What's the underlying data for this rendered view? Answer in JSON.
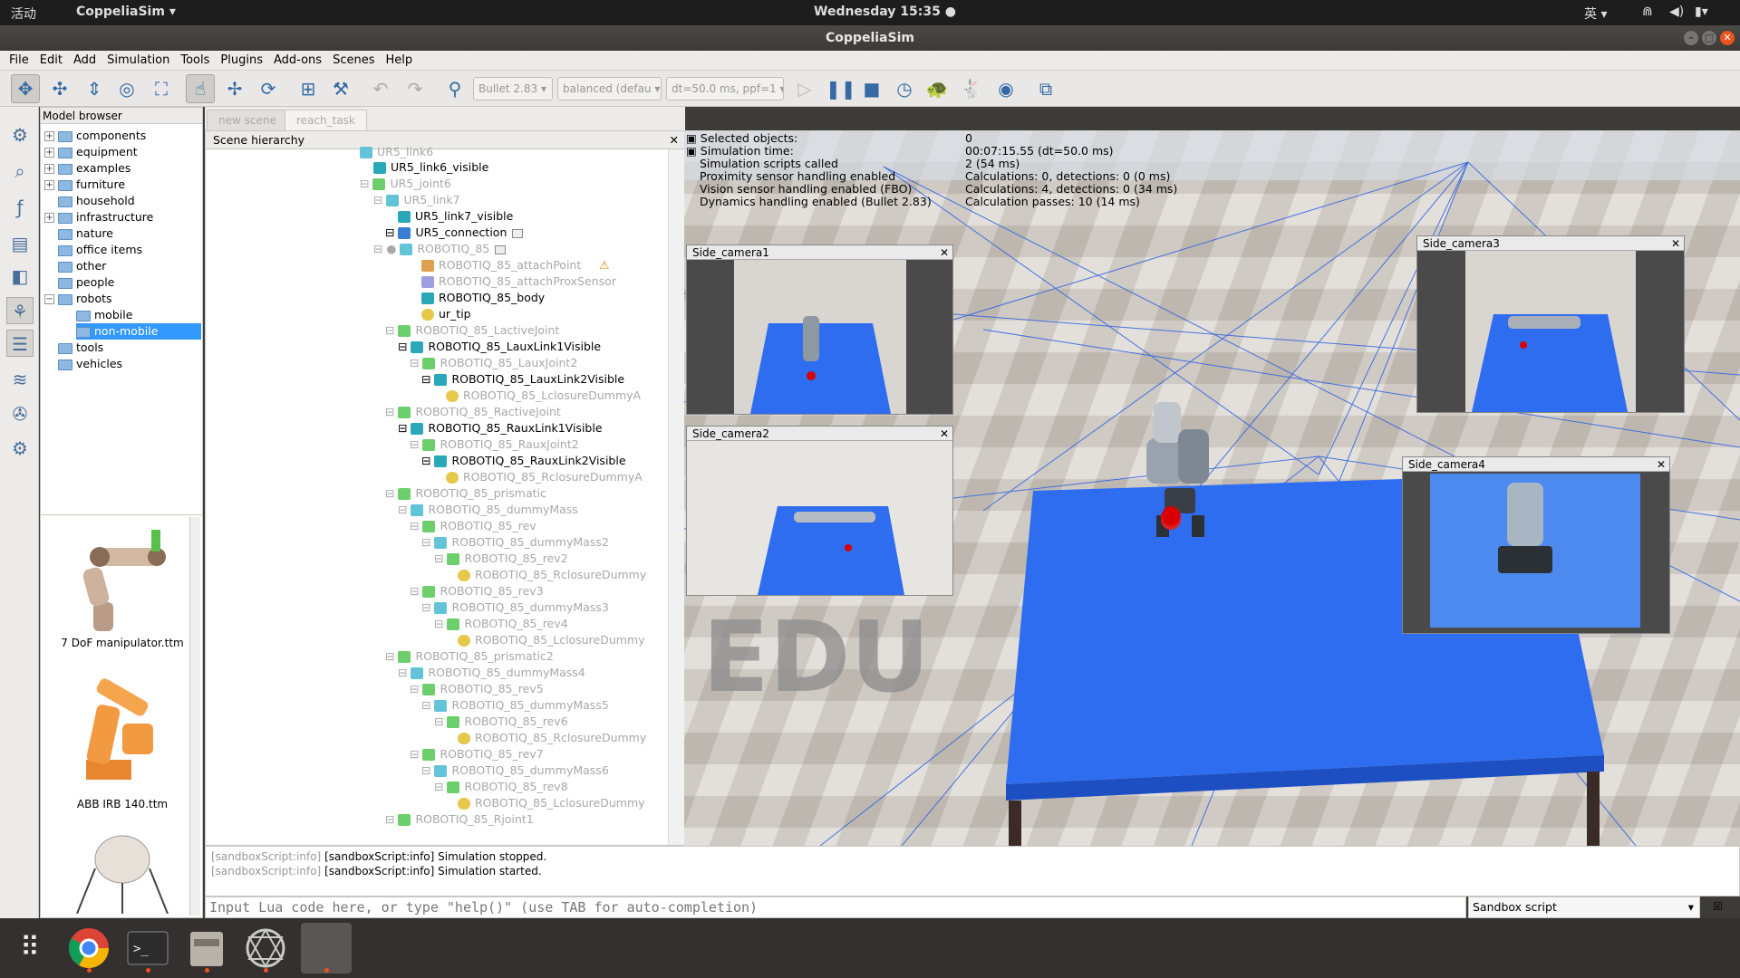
{
  "topbar": {
    "activities": "活动",
    "app_menu": "CoppeliaSim ▾",
    "clock": "Wednesday 15:35 ●",
    "ime": "英 ▾"
  },
  "window": {
    "title": "CoppeliaSim",
    "min": "–",
    "max": "□",
    "close": "✕"
  },
  "menu": [
    "File",
    "Edit",
    "Add",
    "Simulation",
    "Tools",
    "Plugins",
    "Add-ons",
    "Scenes",
    "Help"
  ],
  "toolbar": {
    "engine": "Bullet 2.83",
    "mode": "balanced (defau",
    "dt": "dt=50.0 ms, ppf=1"
  },
  "model_browser": {
    "title": "Model browser",
    "items": [
      "components",
      "equipment",
      "examples",
      "furniture",
      "household",
      "infrastructure",
      "nature",
      "office items",
      "other",
      "people",
      "robots",
      "mobile",
      "non-mobile",
      "tools",
      "vehicles"
    ],
    "thumbs": [
      "7 DoF manipulator.ttm",
      "ABB IRB 140.ttm"
    ]
  },
  "scene_tabs": [
    "new scene",
    "reach_task"
  ],
  "hierarchy": {
    "title": "Scene hierarchy",
    "close": "✕",
    "nodes": [
      "UR5_link6",
      "UR5_link6_visible",
      "UR5_joint6",
      "UR5_link7",
      "UR5_link7_visible",
      "UR5_connection",
      "ROBOTIQ_85",
      "ROBOTIQ_85_attachPoint",
      "ROBOTIQ_85_attachProxSensor",
      "ROBOTIQ_85_body",
      "ur_tip",
      "ROBOTIQ_85_LactiveJoint",
      "ROBOTIQ_85_LauxLink1Visible",
      "ROBOTIQ_85_LauxJoint2",
      "ROBOTIQ_85_LauxLink2Visible",
      "ROBOTIQ_85_LclosureDummyA",
      "ROBOTIQ_85_RactiveJoint",
      "ROBOTIQ_85_RauxLink1Visible",
      "ROBOTIQ_85_RauxJoint2",
      "ROBOTIQ_85_RauxLink2Visible",
      "ROBOTIQ_85_RclosureDummyA",
      "ROBOTIQ_85_prismatic",
      "ROBOTIQ_85_dummyMass",
      "ROBOTIQ_85_rev",
      "ROBOTIQ_85_dummyMass2",
      "ROBOTIQ_85_rev2",
      "ROBOTIQ_85_RclosureDummy",
      "ROBOTIQ_85_rev3",
      "ROBOTIQ_85_dummyMass3",
      "ROBOTIQ_85_rev4",
      "ROBOTIQ_85_LclosureDummy",
      "ROBOTIQ_85_prismatic2",
      "ROBOTIQ_85_dummyMass4",
      "ROBOTIQ_85_rev5",
      "ROBOTIQ_85_dummyMass5",
      "ROBOTIQ_85_rev6",
      "ROBOTIQ_85_RclosureDummy",
      "ROBOTIQ_85_rev7",
      "ROBOTIQ_85_dummyMass6",
      "ROBOTIQ_85_rev8",
      "ROBOTIQ_85_LclosureDummy",
      "ROBOTIQ_85_Rjoint1"
    ]
  },
  "info": {
    "labels": [
      "Selected objects:",
      "Simulation time:",
      "Simulation scripts called",
      "Proximity sensor handling enabled",
      "Vision sensor handling enabled (FBO)",
      "Dynamics handling enabled (Bullet 2.83)"
    ],
    "values": [
      "0",
      "00:07:15.55 (dt=50.0 ms)",
      "2 (54 ms)",
      "Calculations: 0, detections: 0 (0 ms)",
      "Calculations: 4, detections: 0 (34 ms)",
      "Calculation passes: 10 (14 ms)"
    ]
  },
  "cameras": [
    "Side_camera1",
    "Side_camera2",
    "Side_camera3",
    "Side_camera4"
  ],
  "watermark": "EDU",
  "console": [
    "[sandboxScript:info] Simulation stopped.",
    "[sandboxScript:info] Simulation started."
  ],
  "lua_input_placeholder": "Input Lua code here, or type \"help()\" (use TAB for auto-completion)",
  "sandbox_select": "Sandbox script",
  "colors": {
    "floor_blue": "#2f6df0",
    "ubuntu_orange": "#e95420",
    "selection": "#3399ff"
  }
}
